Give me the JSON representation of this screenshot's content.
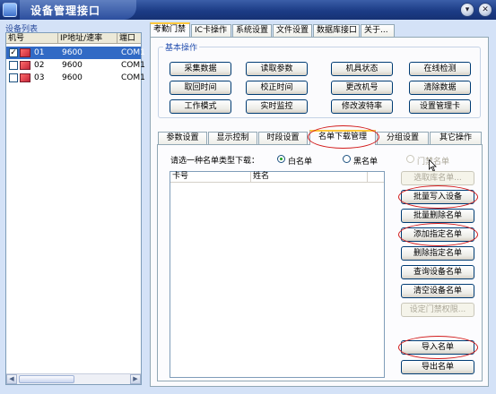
{
  "window": {
    "title": "设备管理接口",
    "min_glyph": "▾",
    "close_glyph": "✕"
  },
  "device_list": {
    "label": "设备列表",
    "columns": [
      "机号",
      "IP地址/速率",
      "端口"
    ],
    "rows": [
      {
        "id": "01",
        "rate": "9600",
        "port": "COM1",
        "checked": true,
        "selected": true
      },
      {
        "id": "02",
        "rate": "9600",
        "port": "COM1",
        "checked": false,
        "selected": false
      },
      {
        "id": "03",
        "rate": "9600",
        "port": "COM1",
        "checked": false,
        "selected": false
      }
    ],
    "check_mark": "✓",
    "scroll_left": "◀",
    "scroll_right": "▶"
  },
  "top_tabs": [
    "考勤门禁",
    "IC卡操作",
    "系统设置",
    "文件设置",
    "数据库接口",
    "关于..."
  ],
  "basic_ops": {
    "legend": "基本操作",
    "buttons": [
      [
        "采集数据",
        "读取参数",
        "机具状态",
        "在线检测"
      ],
      [
        "取回时间",
        "校正时间",
        "更改机号",
        "清除数据"
      ],
      [
        "工作模式",
        "实时监控",
        "修改波特率",
        "设置管理卡"
      ]
    ]
  },
  "sub_tabs": [
    "参数设置",
    "显示控制",
    "时段设置",
    "名单下载管理",
    "分组设置",
    "其它操作"
  ],
  "name_download": {
    "prompt": "请选一种名单类型下载：",
    "radios": [
      {
        "label": "白名单",
        "checked": true,
        "disabled": false
      },
      {
        "label": "黑名单",
        "checked": false,
        "disabled": false
      },
      {
        "label": "门禁名单",
        "checked": false,
        "disabled": true
      }
    ],
    "list_columns": [
      "卡号",
      "姓名"
    ],
    "buttons": [
      {
        "label": "选取库名单...",
        "disabled": true
      },
      {
        "label": "批量写入设备",
        "disabled": false
      },
      {
        "label": "批量删除名单",
        "disabled": false
      },
      {
        "label": "添加指定名单",
        "disabled": false
      },
      {
        "label": "删除指定名单",
        "disabled": false
      },
      {
        "label": "查询设备名单",
        "disabled": false
      },
      {
        "label": "清空设备名单",
        "disabled": false
      },
      {
        "label": "设定门禁权限...",
        "disabled": true
      },
      {
        "label": "导入名单",
        "disabled": false
      },
      {
        "label": "导出名单",
        "disabled": false
      }
    ]
  },
  "colors": {
    "annotation_ring": "#d21c1c",
    "accent_tab": "#ffc83c",
    "selection": "#316ac5"
  }
}
